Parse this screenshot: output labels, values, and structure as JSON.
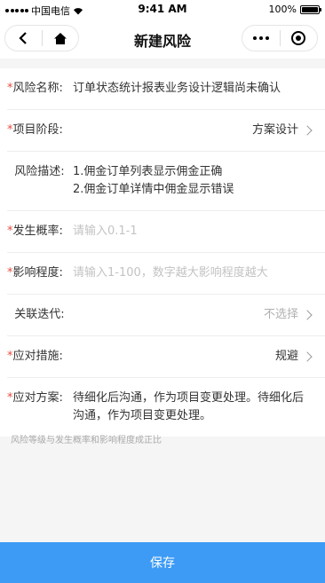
{
  "status_bar": {
    "carrier": "中国电信",
    "time": "9:41 AM",
    "battery": "100%"
  },
  "nav": {
    "title": "新建风险"
  },
  "form": {
    "risk_name": {
      "label": "风险名称:",
      "value": "订单状态统计报表业务设计逻辑尚未确认",
      "required": true
    },
    "project_stage": {
      "label": "项目阶段:",
      "value": "方案设计",
      "required": true
    },
    "risk_desc": {
      "label": "风险描述:",
      "line1": "1.佣金订单列表显示佣金正确",
      "line2": "2.佣金订单详情中佣金显示错误",
      "required": false
    },
    "probability": {
      "label": "发生概率:",
      "placeholder": "请输入0.1-1",
      "required": true
    },
    "impact": {
      "label": "影响程度:",
      "placeholder": "请输入1-100，数字越大影响程度越大",
      "required": true
    },
    "iteration": {
      "label": "关联迭代:",
      "value": "不选择",
      "required": false
    },
    "measure": {
      "label": "应对措施:",
      "value": "规避",
      "required": true
    },
    "plan": {
      "label": "应对方案:",
      "value": "待细化后沟通，作为项目变更处理。待细化后沟通，作为项目变更处理。",
      "required": true
    }
  },
  "hint": "风险等级与发生概率和影响程度成正比",
  "save_label": "保存",
  "colors": {
    "accent": "#3d9bf5",
    "required": "#e54d42"
  }
}
